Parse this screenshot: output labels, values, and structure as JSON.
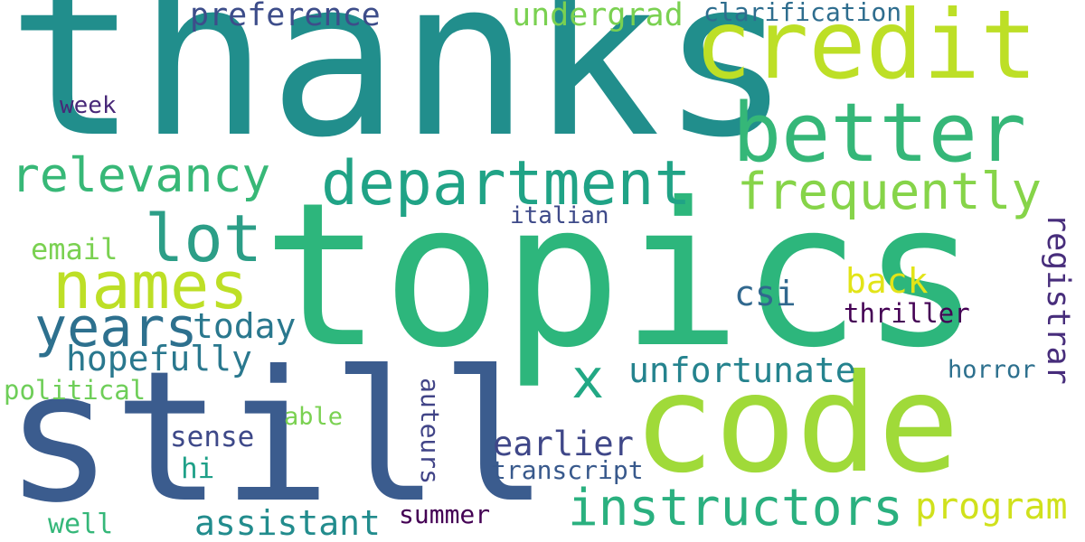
{
  "words": [
    {
      "text": "thanks",
      "color": "#218e8c"
    },
    {
      "text": "topics",
      "color": "#2db67c"
    },
    {
      "text": "still",
      "color": "#3b5c8e"
    },
    {
      "text": "code",
      "color": "#a0da39"
    },
    {
      "text": "credit",
      "color": "#bddf26"
    },
    {
      "text": "better",
      "color": "#35b778"
    },
    {
      "text": "department",
      "color": "#20a386"
    },
    {
      "text": "frequently",
      "color": "#86d449"
    },
    {
      "text": "relevancy",
      "color": "#37b877"
    },
    {
      "text": "lot",
      "color": "#2c9e87"
    },
    {
      "text": "names",
      "color": "#bddf26"
    },
    {
      "text": "years",
      "color": "#2d708e"
    },
    {
      "text": "instructors",
      "color": "#2ab07f"
    },
    {
      "text": "preference",
      "color": "#3d4d8a"
    },
    {
      "text": "undergrad",
      "color": "#7ad151"
    },
    {
      "text": "clarification",
      "color": "#2e6d8e"
    },
    {
      "text": "week",
      "color": "#482878"
    },
    {
      "text": "italian",
      "color": "#3e4a89"
    },
    {
      "text": "email",
      "color": "#7ad151"
    },
    {
      "text": "registrar",
      "color": "#472d7b"
    },
    {
      "text": "back",
      "color": "#e2e418"
    },
    {
      "text": "csi",
      "color": "#31688e"
    },
    {
      "text": "today",
      "color": "#2a788e"
    },
    {
      "text": "thriller",
      "color": "#440154"
    },
    {
      "text": "hopefully",
      "color": "#2a788e"
    },
    {
      "text": "x",
      "color": "#22a884"
    },
    {
      "text": "unfortunate",
      "color": "#25838e"
    },
    {
      "text": "horror",
      "color": "#2d708e"
    },
    {
      "text": "political",
      "color": "#6ece58"
    },
    {
      "text": "able",
      "color": "#7ad151"
    },
    {
      "text": "auteurs",
      "color": "#414487"
    },
    {
      "text": "sense",
      "color": "#3e4989"
    },
    {
      "text": "earlier",
      "color": "#3f4788"
    },
    {
      "text": "hi",
      "color": "#1fa088"
    },
    {
      "text": "transcript",
      "color": "#38598c"
    },
    {
      "text": "program",
      "color": "#d0e11c"
    },
    {
      "text": "assistant",
      "color": "#228c8d"
    },
    {
      "text": "summer",
      "color": "#440154"
    },
    {
      "text": "well",
      "color": "#35b779"
    }
  ]
}
